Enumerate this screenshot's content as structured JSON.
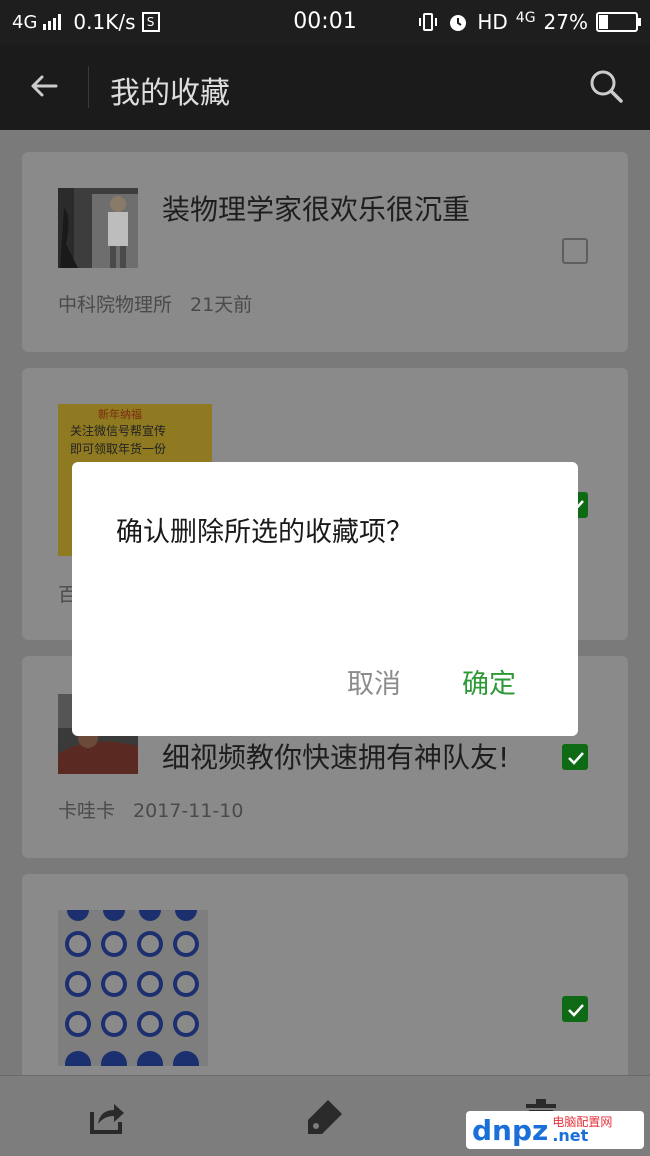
{
  "status_bar": {
    "network": "4G",
    "speed": "0.1K/s",
    "s_badge": "S",
    "time": "00:01",
    "hd": "HD",
    "network_right": "4G",
    "battery_text": "27%",
    "battery_level": 0.27
  },
  "toolbar": {
    "title": "我的收藏"
  },
  "items": [
    {
      "title": "装物理学家很欢乐很沉重",
      "source": "中科院物理所",
      "time": "21天前",
      "checked": false
    },
    {
      "title": "",
      "source": "百",
      "time": "",
      "checked": true,
      "thumb_lines": [
        "新年纳福",
        "关注微信号帮宣传",
        "即可领取年货一份"
      ]
    },
    {
      "title": "细视频教你快速拥有神队友!",
      "source": "卡哇卡",
      "time": "2017-11-10",
      "checked": true
    },
    {
      "title": "",
      "source": "",
      "time": "",
      "checked": true
    }
  ],
  "dialog": {
    "message": "确认删除所选的收藏项？",
    "cancel": "取消",
    "confirm": "确定"
  },
  "watermark": {
    "logo": "dnpz",
    "cn": "电脑配置网",
    "en": ".net"
  },
  "colors": {
    "accent_green": "#2e9a37",
    "check_green": "#0e6a14",
    "toolbar": "#1b1b1b"
  }
}
